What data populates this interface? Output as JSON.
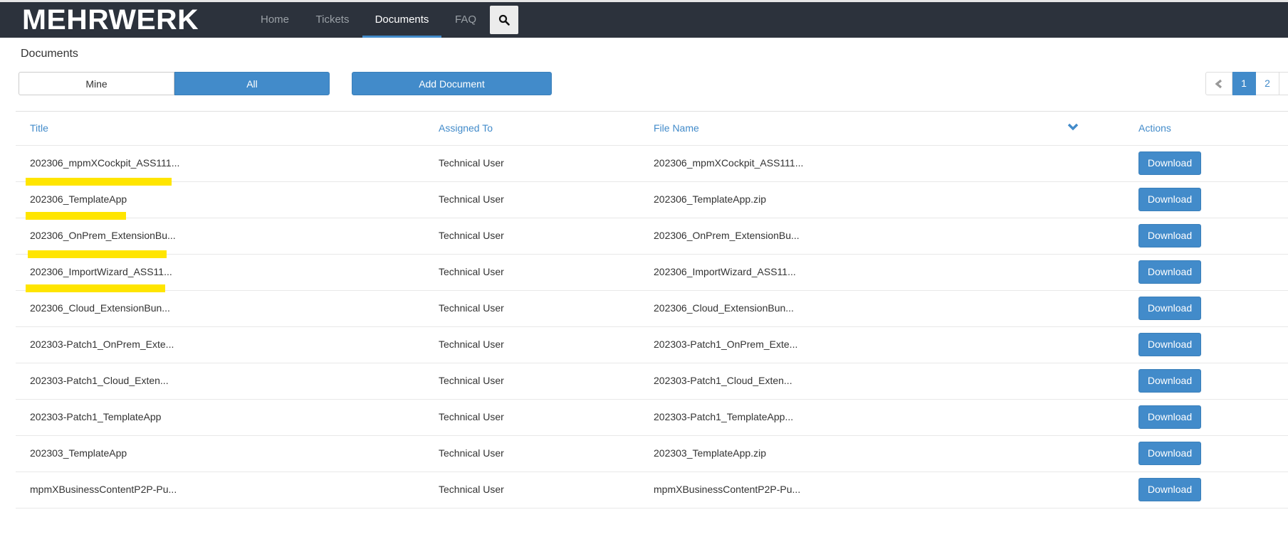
{
  "navbar": {
    "logo": "MEHRWERK",
    "items": [
      {
        "label": "Home",
        "active": false
      },
      {
        "label": "Tickets",
        "active": false
      },
      {
        "label": "Documents",
        "active": true
      },
      {
        "label": "FAQ",
        "active": false
      }
    ],
    "search_icon": "search-icon"
  },
  "page": {
    "title": "Documents",
    "filter": {
      "mine_label": "Mine",
      "all_label": "All",
      "selected": "All"
    },
    "add_label": "Add Document"
  },
  "pagination": {
    "prev_icon": "chevron-left-icon",
    "pages": [
      "1",
      "2"
    ],
    "current": "1"
  },
  "table": {
    "headers": {
      "title": "Title",
      "assigned": "Assigned To",
      "file": "File Name",
      "actions": "Actions"
    },
    "sort_icon": "chevron-down-icon",
    "rows": [
      {
        "title": "202306_mpmXCockpit_ASS111...",
        "assigned": "Technical User",
        "file": "202306_mpmXCockpit_ASS111...",
        "action": "Download",
        "highlighted": true
      },
      {
        "title": "202306_TemplateApp",
        "assigned": "Technical User",
        "file": "202306_TemplateApp.zip",
        "action": "Download",
        "highlighted": true
      },
      {
        "title": "202306_OnPrem_ExtensionBu...",
        "assigned": "Technical User",
        "file": "202306_OnPrem_ExtensionBu...",
        "action": "Download",
        "highlighted": true
      },
      {
        "title": "202306_ImportWizard_ASS11...",
        "assigned": "Technical User",
        "file": "202306_ImportWizard_ASS11...",
        "action": "Download",
        "highlighted": true
      },
      {
        "title": "202306_Cloud_ExtensionBun...",
        "assigned": "Technical User",
        "file": "202306_Cloud_ExtensionBun...",
        "action": "Download",
        "highlighted": false
      },
      {
        "title": "202303-Patch1_OnPrem_Exte...",
        "assigned": "Technical User",
        "file": "202303-Patch1_OnPrem_Exte...",
        "action": "Download",
        "highlighted": false
      },
      {
        "title": "202303-Patch1_Cloud_Exten...",
        "assigned": "Technical User",
        "file": "202303-Patch1_Cloud_Exten...",
        "action": "Download",
        "highlighted": false
      },
      {
        "title": "202303-Patch1_TemplateApp",
        "assigned": "Technical User",
        "file": "202303-Patch1_TemplateApp...",
        "action": "Download",
        "highlighted": false
      },
      {
        "title": "202303_TemplateApp",
        "assigned": "Technical User",
        "file": "202303_TemplateApp.zip",
        "action": "Download",
        "highlighted": false
      },
      {
        "title": "mpmXBusinessContentP2P-Pu...",
        "assigned": "Technical User",
        "file": "mpmXBusinessContentP2P-Pu...",
        "action": "Download",
        "highlighted": false
      }
    ]
  },
  "colors": {
    "navbar_bg": "#2c323c",
    "accent": "#428bca",
    "highlight": "#ffe500"
  }
}
